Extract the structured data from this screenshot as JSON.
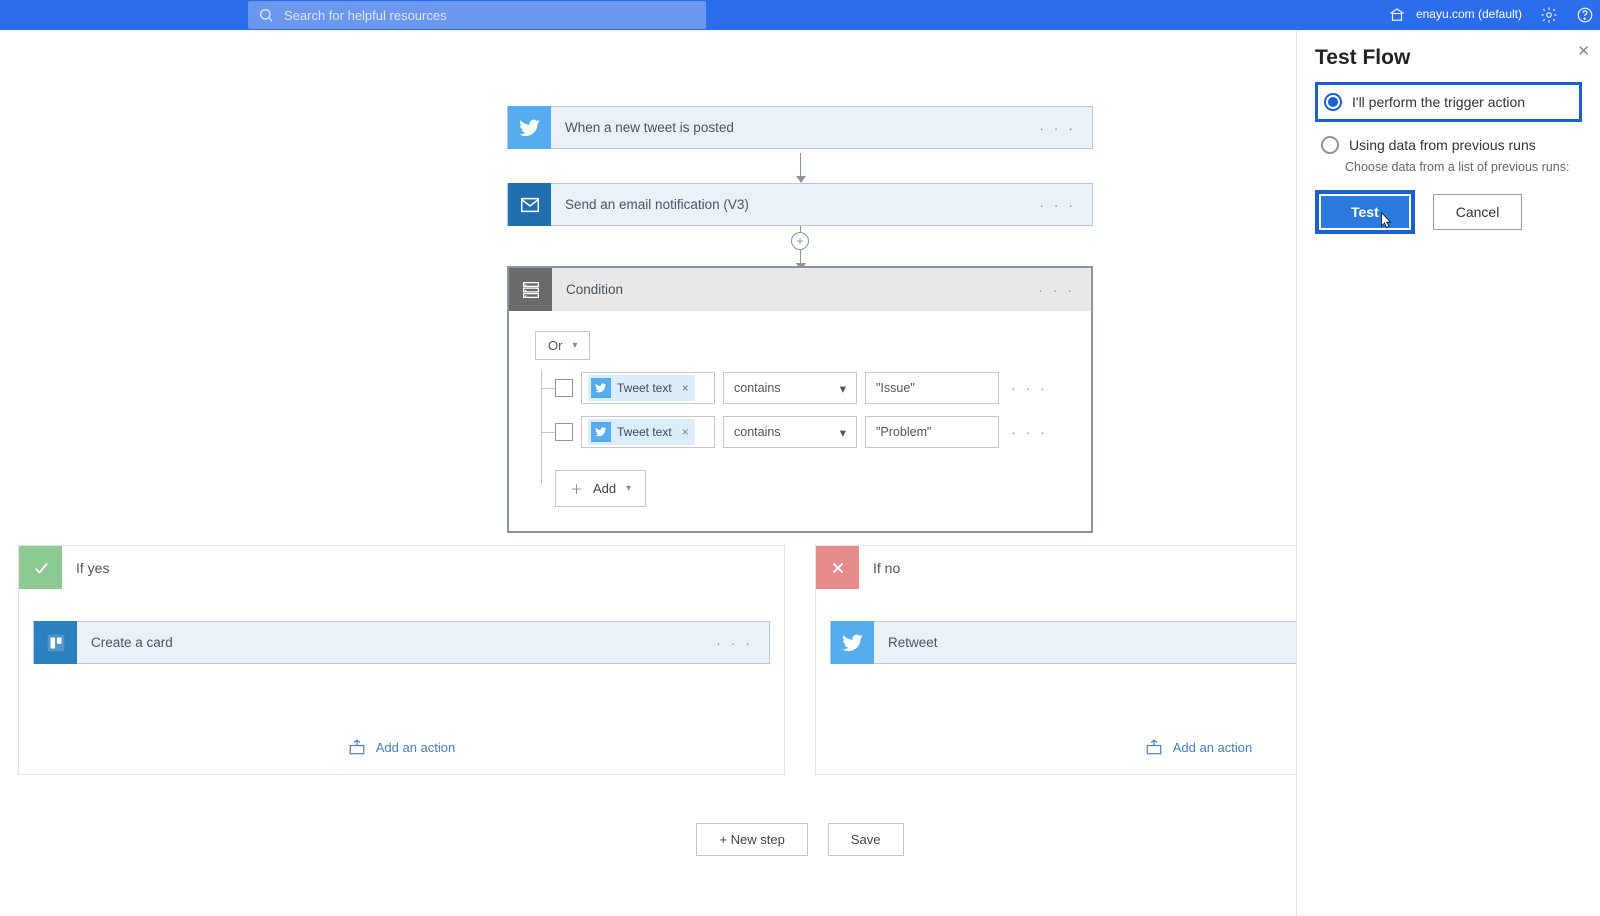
{
  "header": {
    "search_placeholder": "Search for helpful resources",
    "environment_line1": "",
    "environment_line2": "enayu.com (default)"
  },
  "flow": {
    "trigger_label": "When a new tweet is posted",
    "action1_label": "Send an email notification (V3)",
    "condition": {
      "title": "Condition",
      "logic": "Or",
      "rows": [
        {
          "token": "Tweet text",
          "operator": "contains",
          "value": "\"Issue\""
        },
        {
          "token": "Tweet text",
          "operator": "contains",
          "value": "\"Problem\""
        }
      ],
      "add_label": "Add"
    },
    "branches": {
      "yes_label": "If yes",
      "no_label": "If no",
      "yes_step": "Create a card",
      "no_step": "Retweet",
      "add_action_label": "Add an action"
    },
    "footer": {
      "new_step": "+ New step",
      "save": "Save"
    }
  },
  "panel": {
    "title": "Test Flow",
    "opt1": "I'll perform the trigger action",
    "opt2": "Using data from previous runs",
    "opt2_note": "Choose data from a list of previous runs:",
    "test_btn": "Test",
    "cancel_btn": "Cancel"
  }
}
